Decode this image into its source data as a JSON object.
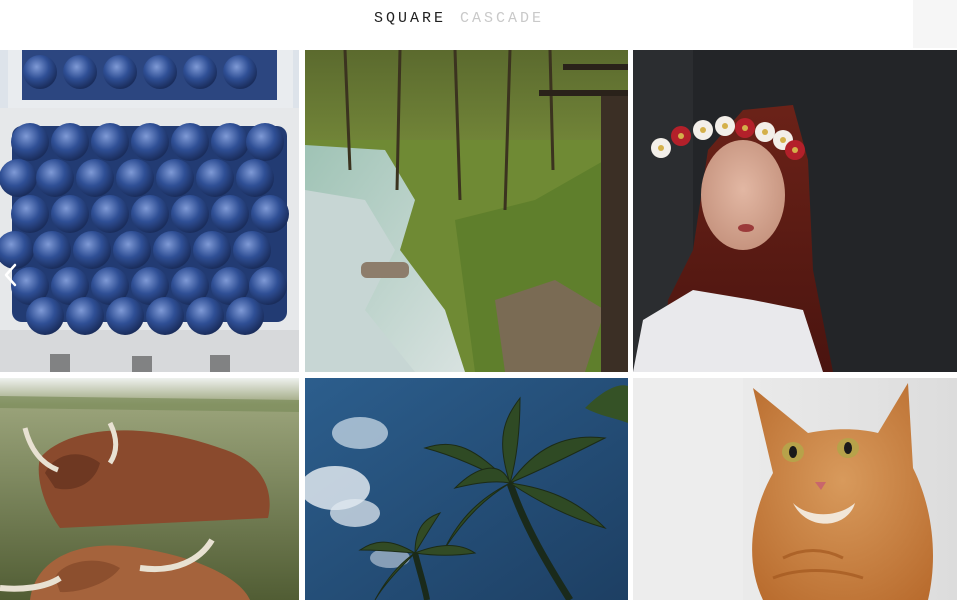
{
  "nav": {
    "tabs": [
      {
        "label": "SQUARE",
        "active": true
      },
      {
        "label": "CASCADE",
        "active": false
      }
    ]
  },
  "gallery": {
    "photos": [
      {
        "subject": "blueberries"
      },
      {
        "subject": "forest-stream"
      },
      {
        "subject": "woman-flower-crown"
      },
      {
        "subject": "highland-cattle"
      },
      {
        "subject": "palm-trees"
      },
      {
        "subject": "orange-cat"
      }
    ],
    "prev_icon": "chevron-left-icon"
  },
  "colors": {
    "active_tab": "#1f1f1f",
    "inactive_tab": "#c9c9c9",
    "background": "#ffffff"
  }
}
